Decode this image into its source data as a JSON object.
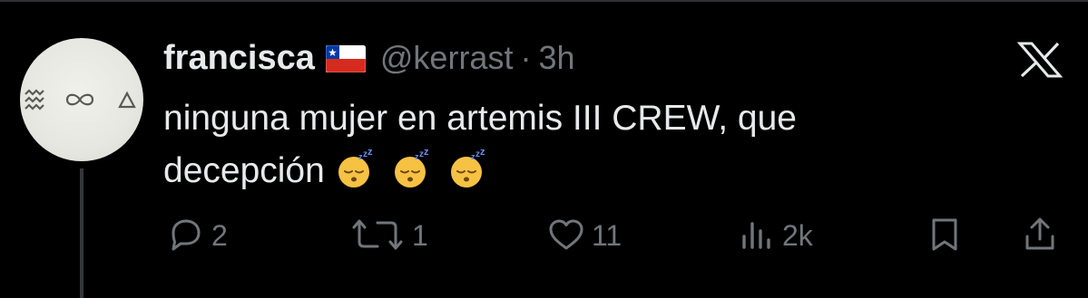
{
  "tweet": {
    "display_name": "francisca",
    "flag_icon": "chile-flag-icon",
    "handle": "@kerrast",
    "separator": "·",
    "time": "3h",
    "text_line1": "ninguna mujer en artemis III CREW, que",
    "text_line2": "decepción",
    "emojis": [
      "sleeping-face-emoji",
      "sleeping-face-emoji",
      "sleeping-face-emoji"
    ],
    "avatar_symbols": "≋ ∞ △"
  },
  "brand": {
    "icon": "x-logo-icon"
  },
  "actions": {
    "replies": {
      "icon": "reply-icon",
      "count": "2"
    },
    "reposts": {
      "icon": "repost-icon",
      "count": "1"
    },
    "likes": {
      "icon": "heart-icon",
      "count": "11"
    },
    "views": {
      "icon": "views-icon",
      "count": "2k"
    },
    "bookmark": {
      "icon": "bookmark-icon"
    },
    "share": {
      "icon": "share-icon"
    }
  },
  "colors": {
    "background": "#000000",
    "text_primary": "#e7e9ea",
    "text_secondary": "#71767b",
    "divider": "#2f3336",
    "flag_red": "#d52b1e",
    "flag_blue": "#0039a6"
  }
}
